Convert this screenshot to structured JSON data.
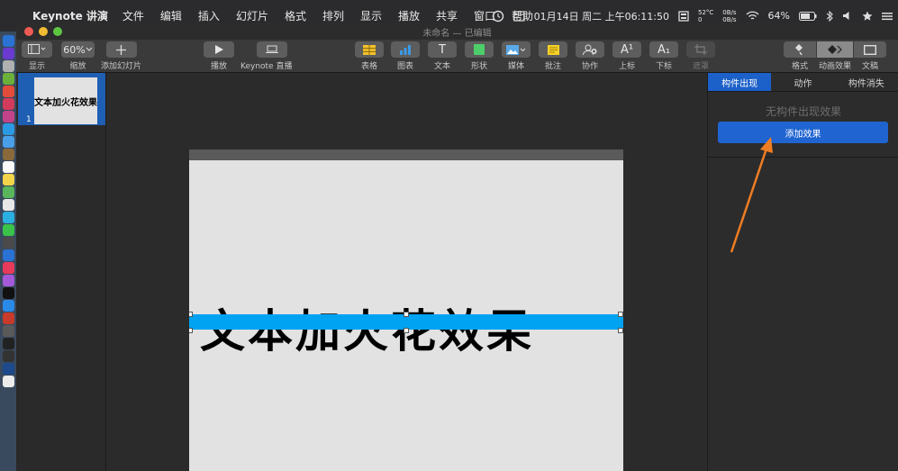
{
  "menubar": {
    "app_name": "Keynote 讲演",
    "items": [
      "文件",
      "编辑",
      "插入",
      "幻灯片",
      "格式",
      "排列",
      "显示",
      "播放",
      "共享",
      "窗口",
      "帮助"
    ],
    "datetime": "01月14日 周二 上午06:11:50",
    "temp_top": "52°C",
    "temp_bottom": "0",
    "net_up": "0B/s",
    "net_down": "0B/s",
    "battery": "64%"
  },
  "window": {
    "title": "未命名 — 已编辑"
  },
  "toolbar": {
    "view_label": "显示",
    "zoom_value": "60%",
    "zoom_label": "缩放",
    "add_slide_label": "添加幻灯片",
    "play_label": "播放",
    "keynote_live_label": "Keynote 直播",
    "table_label": "表格",
    "chart_label": "图表",
    "text_label": "文本",
    "shape_label": "形状",
    "media_label": "媒体",
    "comment_label": "批注",
    "collab_label": "协作",
    "superscript_label": "上标",
    "subscript_label": "下标",
    "mask_label": "遮罩",
    "format_label": "格式",
    "animate_label": "动画效果",
    "document_label": "文稿",
    "text_icon_glyph": "T",
    "superscript_glyph": "A¹",
    "subscript_glyph": "A₁"
  },
  "navigator": {
    "slide_number": "1",
    "thumb_text": "文本加火花效果"
  },
  "slide": {
    "text": "文本加火花效果"
  },
  "inspector": {
    "tabs": [
      "构件出现",
      "动作",
      "构件消失"
    ],
    "no_effect": "无构件出现效果",
    "add_effect": "添加效果"
  },
  "colors": {
    "accent": "#1c60c9",
    "selection": "#00a2f2",
    "arrow": "#ef7d22"
  }
}
